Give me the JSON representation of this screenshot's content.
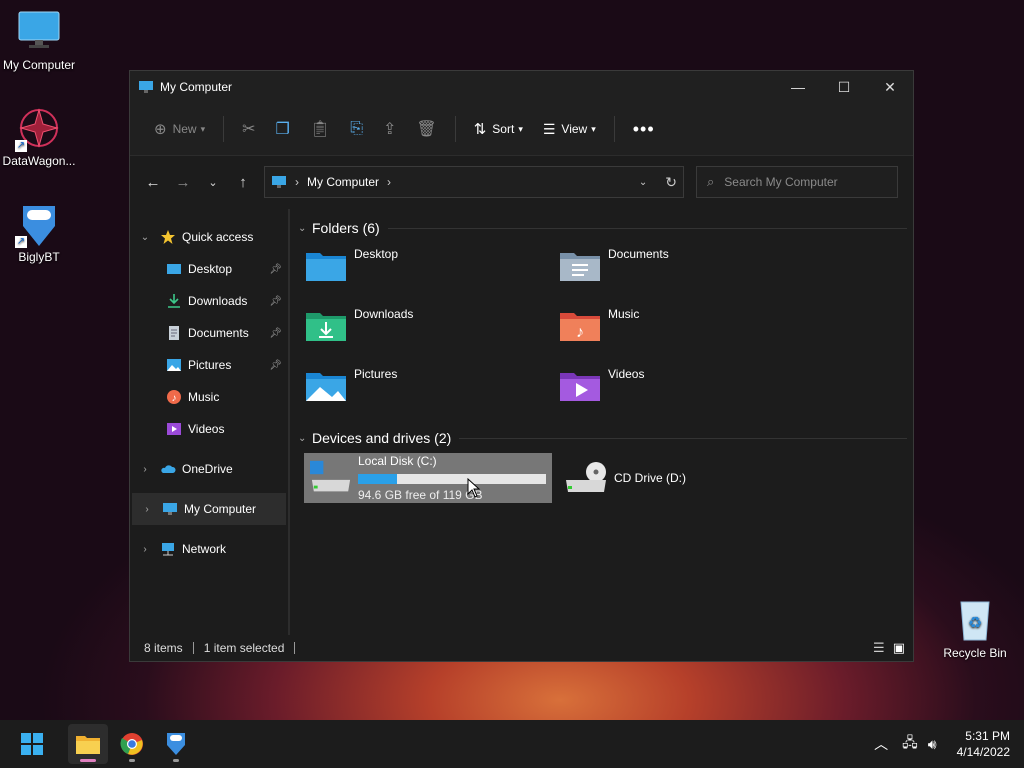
{
  "desktop": {
    "icons": [
      {
        "label": "My Computer"
      },
      {
        "label": "DataWagon..."
      },
      {
        "label": "BiglyBT"
      },
      {
        "label": "Recycle Bin"
      }
    ]
  },
  "window": {
    "title": "My Computer",
    "toolbar": {
      "new": "New",
      "sort": "Sort",
      "view": "View"
    },
    "address": {
      "crumb": "My Computer"
    },
    "search": {
      "placeholder": "Search My Computer"
    },
    "sidebar": {
      "quick_access": "Quick access",
      "items": [
        "Desktop",
        "Downloads",
        "Documents",
        "Pictures",
        "Music",
        "Videos"
      ],
      "onedrive": "OneDrive",
      "my_computer": "My Computer",
      "network": "Network"
    },
    "folders_header": "Folders (6)",
    "folders": [
      "Desktop",
      "Documents",
      "Downloads",
      "Music",
      "Pictures",
      "Videos"
    ],
    "drives_header": "Devices and drives (2)",
    "drives": [
      {
        "name": "Local Disk (C:)",
        "free": "94.6 GB free of 119 GB",
        "used_fraction": 0.205
      },
      {
        "name": "CD Drive (D:)"
      }
    ],
    "status": {
      "items": "8 items",
      "selected": "1 item selected"
    }
  },
  "taskbar": {
    "time": "5:31 PM",
    "date": "4/14/2022"
  },
  "colors": {
    "accent": "#2aa0e8",
    "window_bg": "#1c1c1c"
  }
}
